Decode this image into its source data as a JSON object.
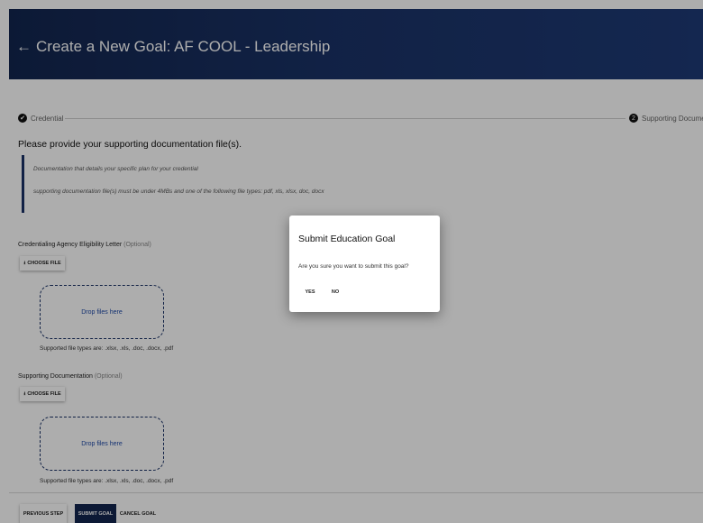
{
  "header": {
    "back_glyph": "←",
    "title": "Create a New Goal: AF COOL - Leadership"
  },
  "stepper": {
    "step1": {
      "glyph": "✔",
      "label": "Credential"
    },
    "step2": {
      "glyph": "2",
      "label": "Supporting Documentation"
    }
  },
  "form": {
    "heading": "Please provide your supporting documentation file(s).",
    "note": {
      "line1": "Documentation that details your specific plan for your credential",
      "line2": "supporting documentation file(s) must be under 4MBs and one of the following file types: pdf, xls, xlsx, doc, docx"
    },
    "sections": [
      {
        "label": "Credentialing Agency Eligibility Letter",
        "optional": "(Optional)",
        "choose_file": "CHOOSE FILE",
        "dropzone": "Drop files here",
        "supported_types": "Supported file types are: .xlsx, .xls, .doc, .docx, .pdf"
      },
      {
        "label": "Supporting Documentation",
        "optional": "(Optional)",
        "choose_file": "CHOOSE FILE",
        "dropzone": "Drop files here",
        "supported_types": "Supported file types are: .xlsx, .xls, .doc, .docx, .pdf"
      }
    ]
  },
  "footer": {
    "previous_step": "PREVIOUS STEP",
    "submit_goal": "SUBMIT GOAL",
    "cancel_goal": "CANCEL GOAL"
  },
  "dialog": {
    "title": "Submit Education Goal",
    "message": "Are you sure you want to submit this goal?",
    "yes": "YES",
    "no": "NO"
  },
  "colors": {
    "header_bg": "#1a3266",
    "primary_button": "#13264f",
    "dropzone_text": "#1f4aa8",
    "overlay": "rgba(0,0,0,0.32)"
  }
}
